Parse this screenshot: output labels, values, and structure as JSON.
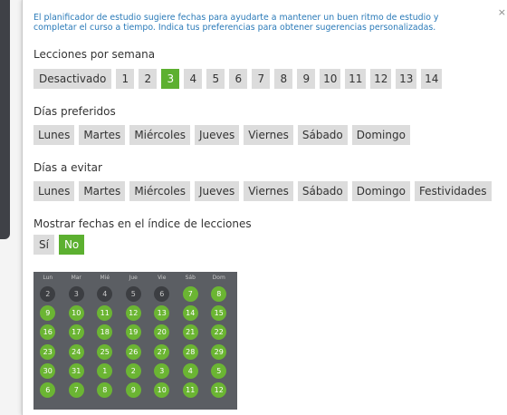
{
  "intro": {
    "line1": "El planificador de estudio sugiere fechas para ayudarte a mantener un buen ritmo de estudio y",
    "line2": "completar el curso a tiempo. Indica tus preferencias para obtener sugerencias personalizadas."
  },
  "close_label": "×",
  "lessons": {
    "title": "Lecciones por semana",
    "options": [
      "Desactivado",
      "1",
      "2",
      "3",
      "4",
      "5",
      "6",
      "7",
      "8",
      "9",
      "10",
      "11",
      "12",
      "13",
      "14"
    ],
    "selected": "3"
  },
  "preferred": {
    "title": "Días preferidos",
    "options": [
      "Lunes",
      "Martes",
      "Miércoles",
      "Jueves",
      "Viernes",
      "Sábado",
      "Domingo"
    ]
  },
  "avoid": {
    "title": "Días a evitar",
    "options": [
      "Lunes",
      "Martes",
      "Miércoles",
      "Jueves",
      "Viernes",
      "Sábado",
      "Domingo",
      "Festividades"
    ]
  },
  "show_dates": {
    "title": "Mostrar fechas en el índice de lecciones",
    "options": [
      "Sí",
      "No"
    ],
    "selected": "No"
  },
  "calendar": {
    "weekdays": [
      "Lun",
      "Mar",
      "Mié",
      "Jue",
      "Vie",
      "Sáb",
      "Dom"
    ],
    "weeks": [
      [
        "2",
        "3",
        "4",
        "5",
        "6",
        "7",
        "8"
      ],
      [
        "9",
        "10",
        "11",
        "12",
        "13",
        "14",
        "15"
      ],
      [
        "16",
        "17",
        "18",
        "19",
        "20",
        "21",
        "22"
      ],
      [
        "23",
        "24",
        "25",
        "26",
        "27",
        "28",
        "29"
      ],
      [
        "30",
        "31",
        "1",
        "2",
        "3",
        "4",
        "5"
      ],
      [
        "6",
        "7",
        "8",
        "9",
        "10",
        "11",
        "12"
      ]
    ],
    "past_days": 5,
    "colors": {
      "available": "#6bb533",
      "past": "#3c3e42",
      "background": "#5b5e63"
    }
  },
  "colors": {
    "accent": "#5cb030",
    "button": "#dcdcdc",
    "intro_text": "#2a7ab8"
  }
}
